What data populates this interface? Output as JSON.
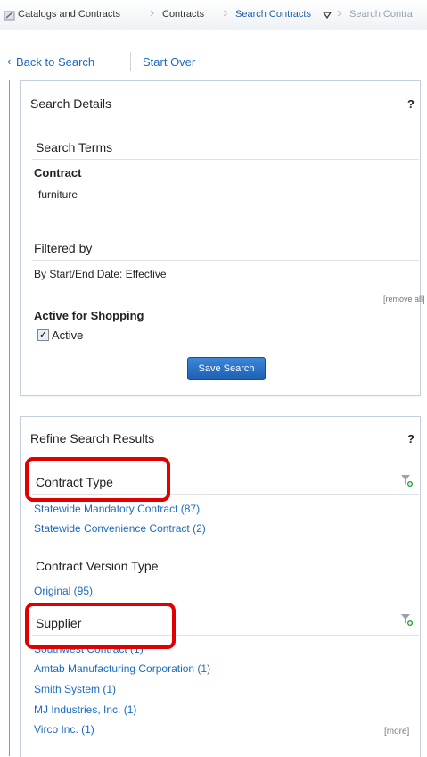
{
  "breadcrumb": {
    "items": [
      "Catalogs and Contracts",
      "Contracts",
      "Search Contracts",
      "Search Contra"
    ]
  },
  "nav": {
    "back": "Back to Search",
    "start_over": "Start Over"
  },
  "search_details": {
    "title": "Search Details",
    "help": "?",
    "terms_heading": "Search Terms",
    "contract_label": "Contract",
    "contract_value": "furniture",
    "filtered_heading": "Filtered by",
    "filter_value": "By Start/End Date: Effective",
    "remove_all": "[remove all]",
    "active_heading": "Active for Shopping",
    "active_label": "Active",
    "active_checked": true,
    "save_button": "Save Search"
  },
  "refine": {
    "title": "Refine Search Results",
    "help": "?",
    "contract_type": {
      "heading": "Contract Type",
      "items": [
        "Statewide Mandatory Contract (87)",
        "Statewide Convenience Contract (2)"
      ]
    },
    "version_type": {
      "heading": "Contract Version Type",
      "items": [
        "Original (95)"
      ]
    },
    "supplier": {
      "heading": "Supplier",
      "items": [
        "Southwest Contract (1)",
        "Amtab Manufacturing Corporation (1)",
        "Smith System (1)",
        "MJ Industries, Inc. (1)",
        "Virco Inc. (1)"
      ],
      "more": "[more]"
    }
  },
  "colors": {
    "link": "#1b6ac0",
    "highlight": "#e00000",
    "button": "#2a6fc4"
  }
}
